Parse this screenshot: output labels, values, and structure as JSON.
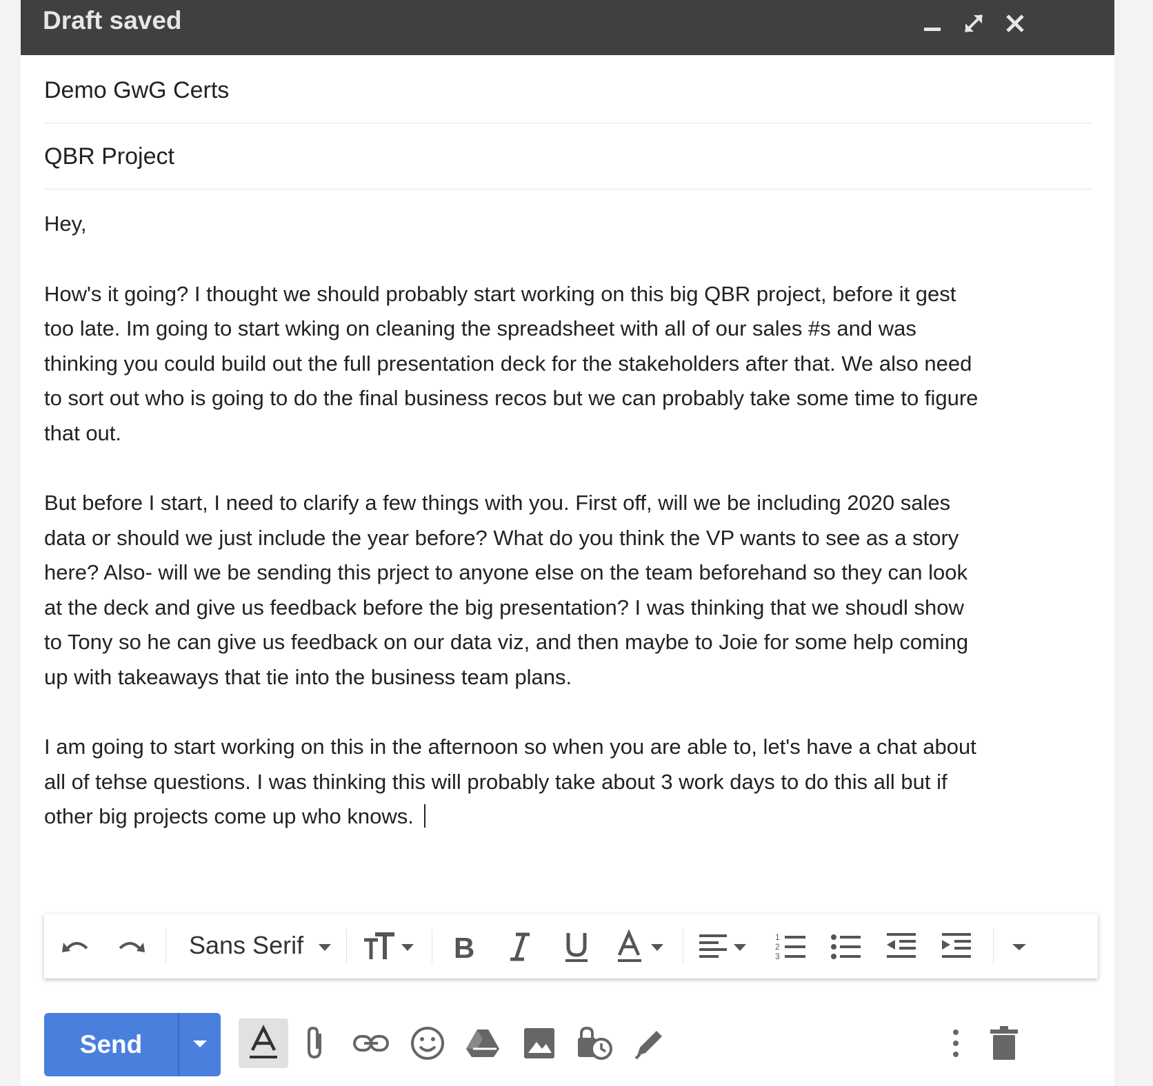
{
  "window": {
    "title": "Draft saved",
    "controls": [
      "minimize-icon",
      "expand-icon",
      "close-icon"
    ]
  },
  "compose": {
    "to": "Demo GwG Certs",
    "subject": "QBR Project",
    "greeting": "Hey,",
    "paragraph1": [
      "How's it going? I thought we should probably start working on this big QBR project, before it gest",
      "too late. Im going to start wking on cleaning the spreadsheet with all of our sales #s and was",
      "thinking you could build out the full presentation deck for the stakeholders after that. We also need",
      "to sort out who is going to do the final business recos but we can probably take some time to figure",
      "that out."
    ],
    "paragraph2": [
      "But before I start, I need to clarify a few things with you. First off, will we be including 2020 sales",
      "data or should we just include the year before? What do you think the VP wants to see as a story",
      "here? Also- will we be sending this prject to anyone else on the team beforehand so they can look",
      "at the deck and give us feedback before the big presentation? I was thinking that we shoudl show",
      "to Tony so he can give us feedback on our data viz, and then maybe to Joie for some help coming",
      "up with takeaways that tie into the business team plans."
    ],
    "paragraph3": [
      "I am going to start working on this in the afternoon so when you are able to, let's have a chat about",
      "all of tehse questions. I was thinking this will probably take about 3 work days to do this all but if",
      "other big projects come up who knows. "
    ]
  },
  "format_toolbar": {
    "font": "Sans Serif",
    "icons": [
      "undo-icon",
      "redo-icon",
      "font-size-icon",
      "bold-icon",
      "italic-icon",
      "underline-icon",
      "text-color-icon",
      "align-icon",
      "numbered-list-icon",
      "bulleted-list-icon",
      "indent-less-icon",
      "indent-more-icon",
      "more-formatting-icon"
    ]
  },
  "bottom_toolbar": {
    "send_label": "Send",
    "icons": [
      "formatting-options-icon",
      "attach-icon",
      "link-icon",
      "emoji-icon",
      "drive-icon",
      "photo-icon",
      "confidential-icon",
      "signature-icon",
      "more-options-icon",
      "trash-icon"
    ]
  },
  "colors": {
    "titlebar": "#404040",
    "send": "#4a7fde",
    "spellcheck": "#d93025"
  }
}
